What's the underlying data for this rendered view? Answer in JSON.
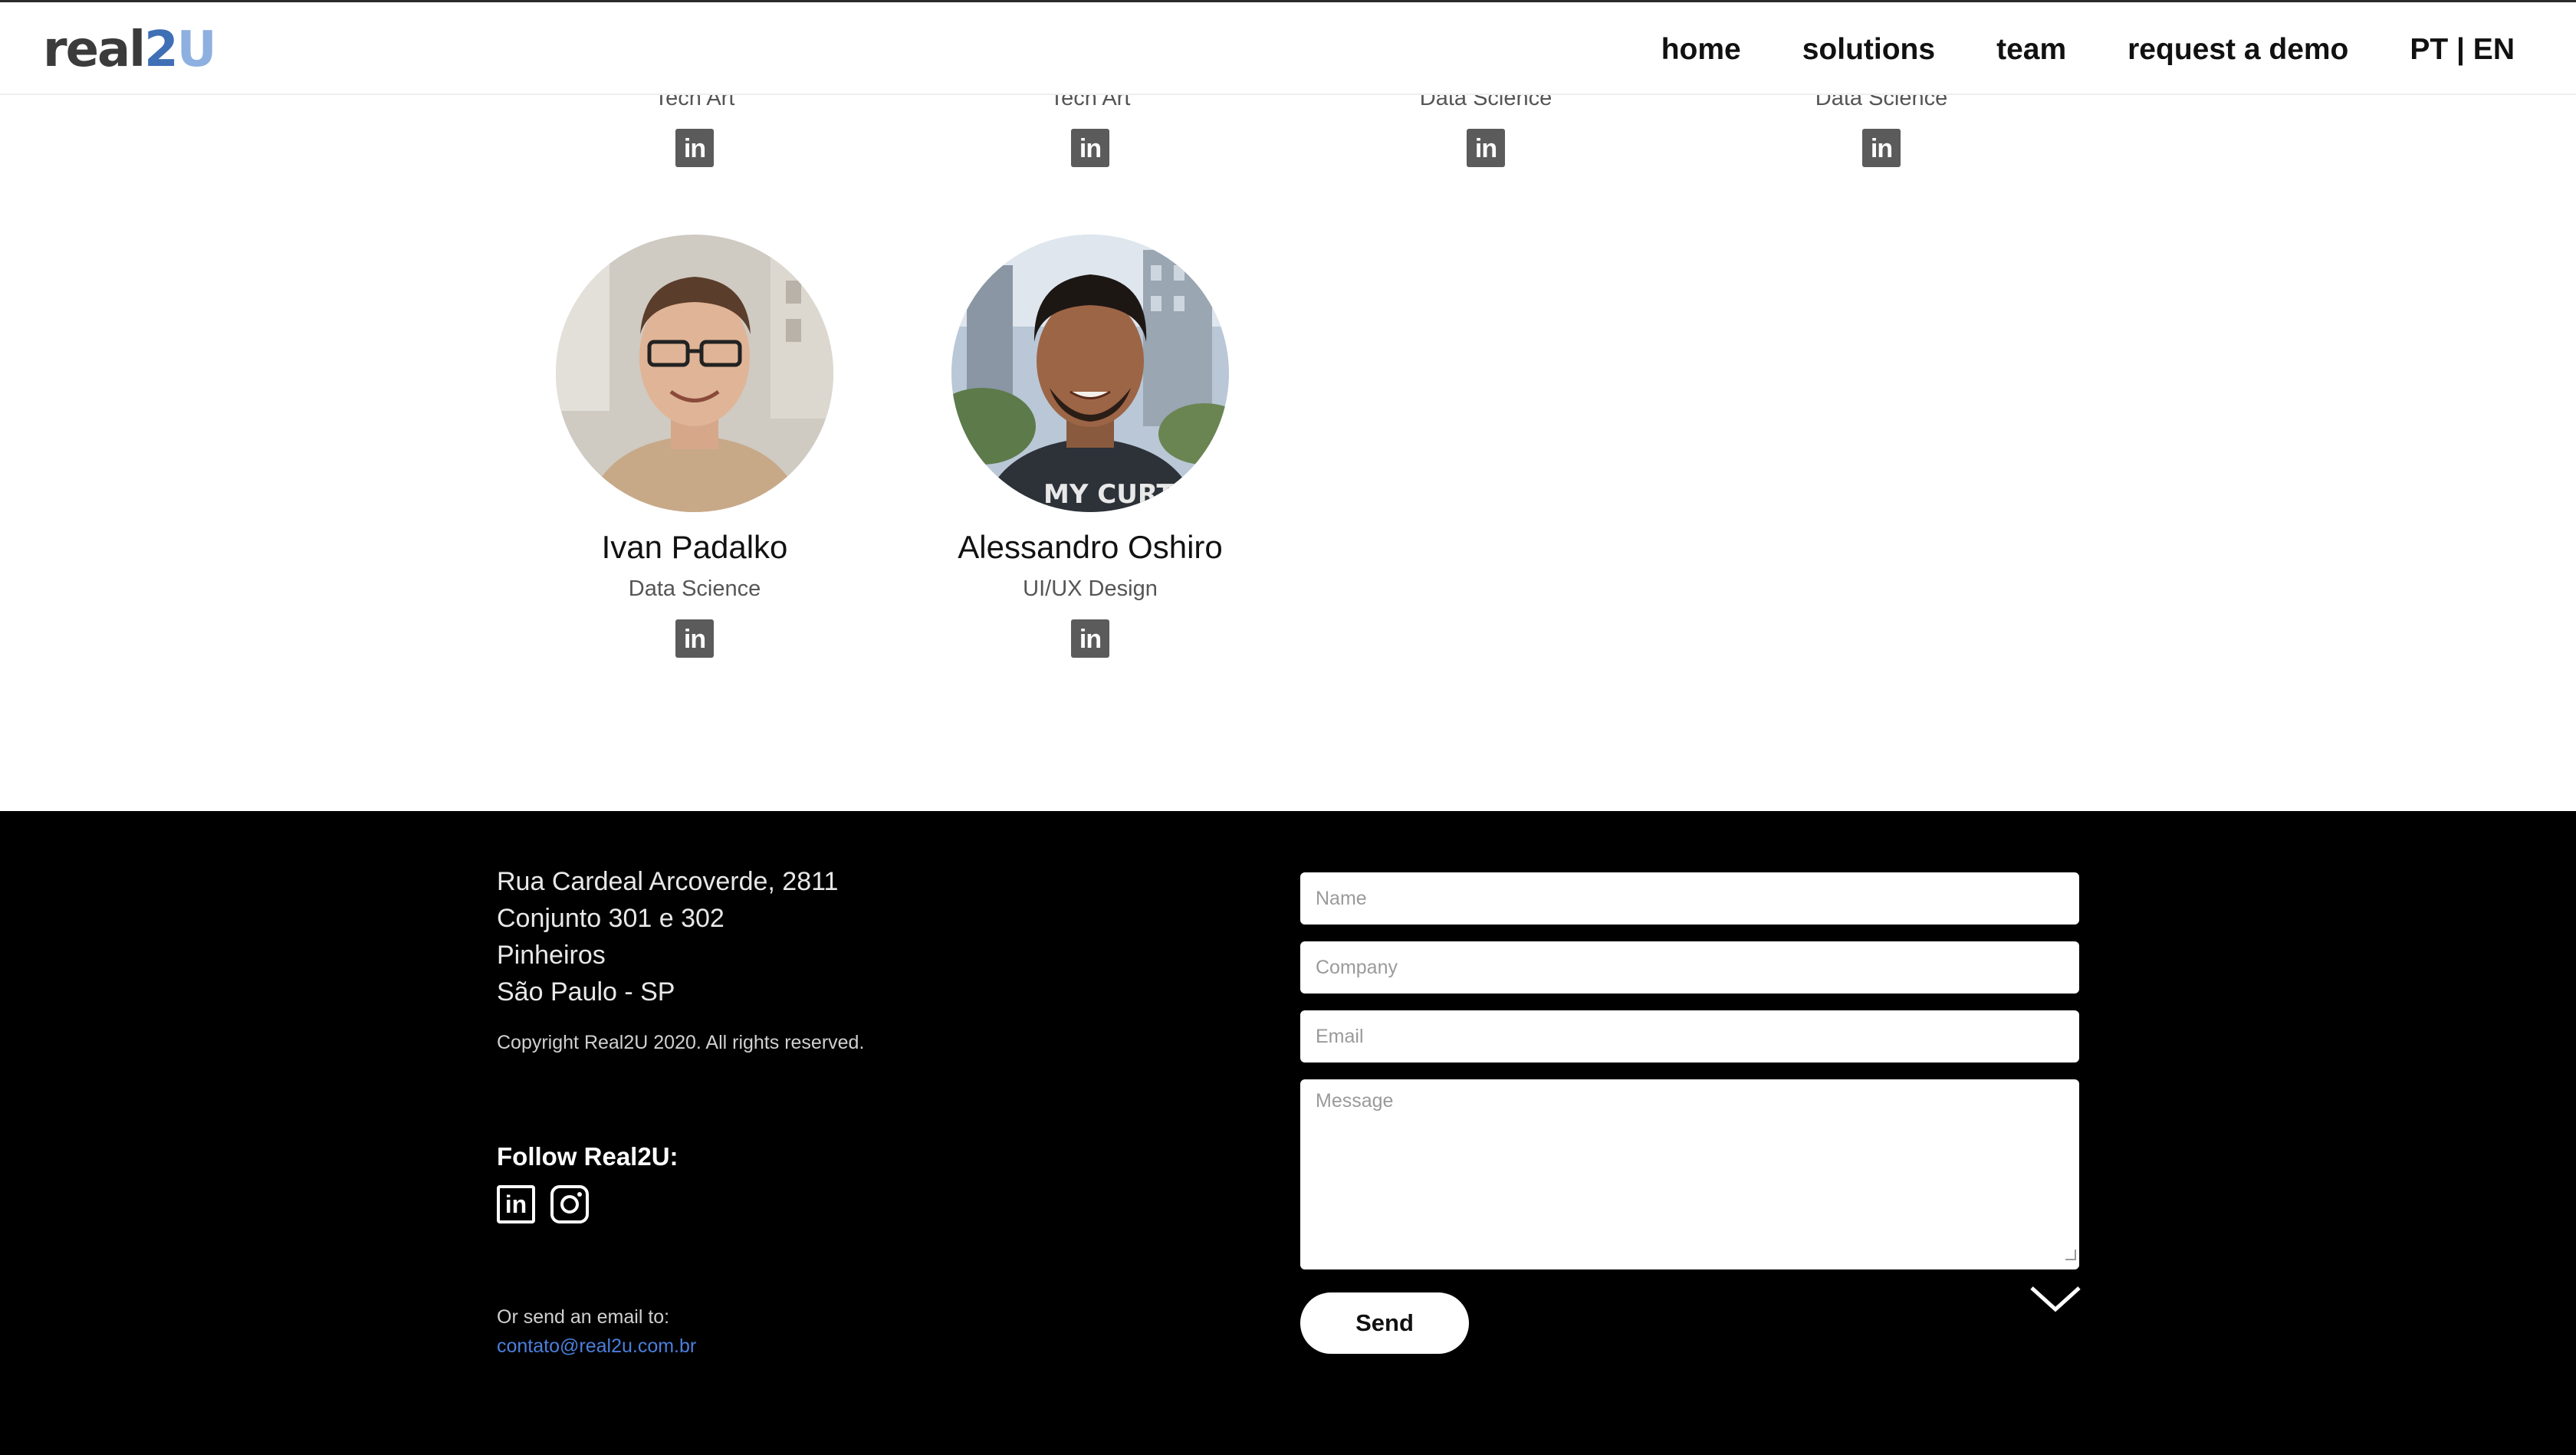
{
  "header": {
    "logo": {
      "part1": "real",
      "part2": "2",
      "part3": "U"
    },
    "nav": [
      "home",
      "solutions",
      "team",
      "request a demo",
      "PT | EN"
    ]
  },
  "team": {
    "top_roles": [
      "Tech Art",
      "Tech Art",
      "Data Science",
      "Data Science"
    ],
    "members": [
      {
        "name": "Ivan Padalko",
        "role": "Data Science"
      },
      {
        "name": "Alessandro Oshiro",
        "role": "UI/UX Design"
      }
    ],
    "linkedin_icon_text": "in"
  },
  "footer": {
    "address": [
      "Rua Cardeal Arcoverde, 2811",
      "Conjunto 301 e 302",
      "Pinheiros",
      "São Paulo - SP"
    ],
    "copyright": "Copyright Real2U 2020. All rights reserved.",
    "follow_label": "Follow Real2U:",
    "email_caption": "Or send an email to:",
    "email": "contato@real2u.com.br",
    "form": {
      "name_placeholder": "Name",
      "company_placeholder": "Company",
      "email_placeholder": "Email",
      "message_placeholder": "Message",
      "send_label": "Send"
    }
  },
  "colors": {
    "footer_bg": "#000000",
    "link_blue": "#4a7fdc",
    "linkedin_gray": "#5b5b5b",
    "logo_blue": "#3f6fb5"
  }
}
